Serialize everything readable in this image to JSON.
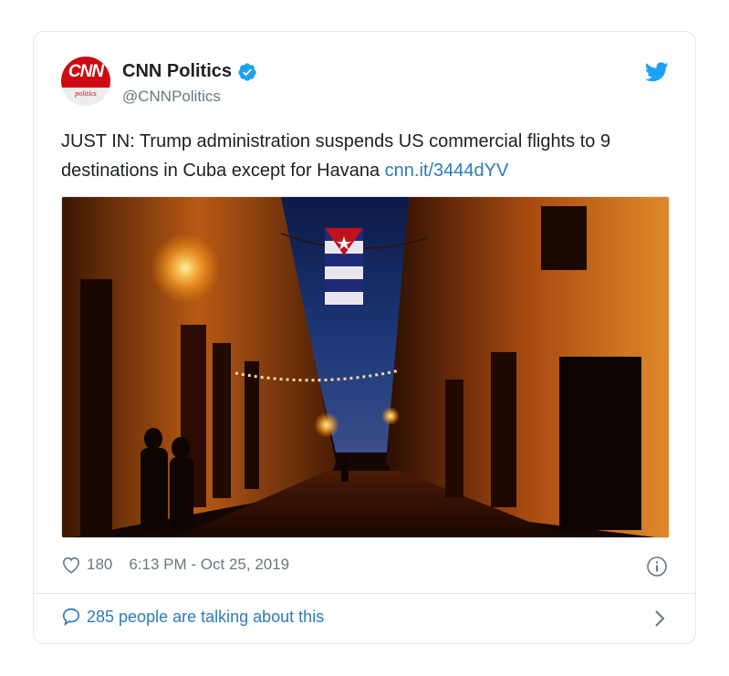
{
  "author": {
    "name": "CNN Politics",
    "handle": "@CNNPolitics",
    "avatar_logo_text": "CNN",
    "avatar_sub_text": "politics",
    "verified": true
  },
  "tweet": {
    "text": "JUST IN: Trump administration suspends US commercial flights to 9 destinations in Cuba except for Havana ",
    "link": "cnn.it/3444dYV"
  },
  "media": {
    "description_icon": "photo-street-cuban-flag"
  },
  "footer": {
    "likes": "180",
    "timestamp": "6:13 PM - Oct 25, 2019",
    "talking": "285 people are talking about this"
  },
  "icons": {
    "verified": "verified-badge-icon",
    "bird": "twitter-bird-icon",
    "heart": "heart-icon",
    "info": "info-icon",
    "bubble": "comment-bubble-icon",
    "chevron": "chevron-right-icon"
  },
  "colors": {
    "link": "#2b7bb9",
    "twitter_blue": "#1da1f2",
    "muted": "#697882",
    "cnn_red": "#cc0a12",
    "border": "#e1e8ed"
  }
}
